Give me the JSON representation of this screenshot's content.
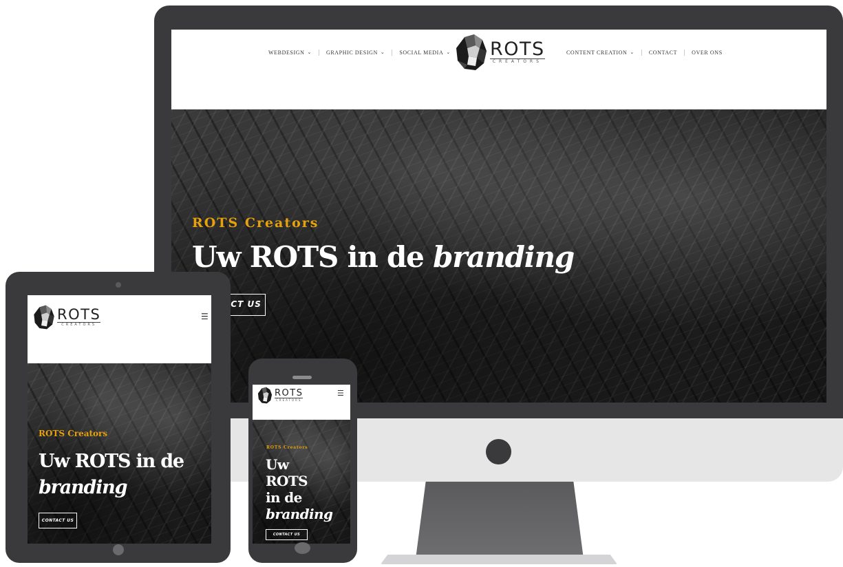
{
  "brand": {
    "name": "ROTS",
    "subtitle": "CREATORS"
  },
  "desktop": {
    "nav_left": [
      {
        "label": "WEBDESIGN",
        "dropdown": true
      },
      {
        "label": "GRAPHIC DESIGN",
        "dropdown": true
      },
      {
        "label": "SOCIAL MEDIA",
        "dropdown": true
      }
    ],
    "nav_right": [
      {
        "label": "CONTENT CREATION",
        "dropdown": true
      },
      {
        "label": "CONTACT",
        "dropdown": false
      },
      {
        "label": "OVER ONS",
        "dropdown": false
      }
    ],
    "hero": {
      "tagline": "ROTS Creators",
      "headline_plain": "Uw ROTS in de ",
      "headline_italic": "branding",
      "cta": "CONTACT US"
    }
  },
  "tablet": {
    "menu_icon": "hamburger-icon",
    "hero": {
      "tagline": "ROTS Creators",
      "headline_plain": "Uw ROTS in de",
      "headline_italic": "branding",
      "cta": "CONTACT US"
    }
  },
  "phone": {
    "menu_icon": "hamburger-icon",
    "hero": {
      "tagline": "ROTS Creators",
      "headline_line1": "Uw",
      "headline_line2": "ROTS",
      "headline_line3": "in de",
      "headline_italic": "branding",
      "cta": "CONTACT US"
    }
  },
  "colors": {
    "accent": "#e6a10e",
    "device_frame": "#3a3a3c",
    "monitor_chin": "#e6e6e7"
  }
}
